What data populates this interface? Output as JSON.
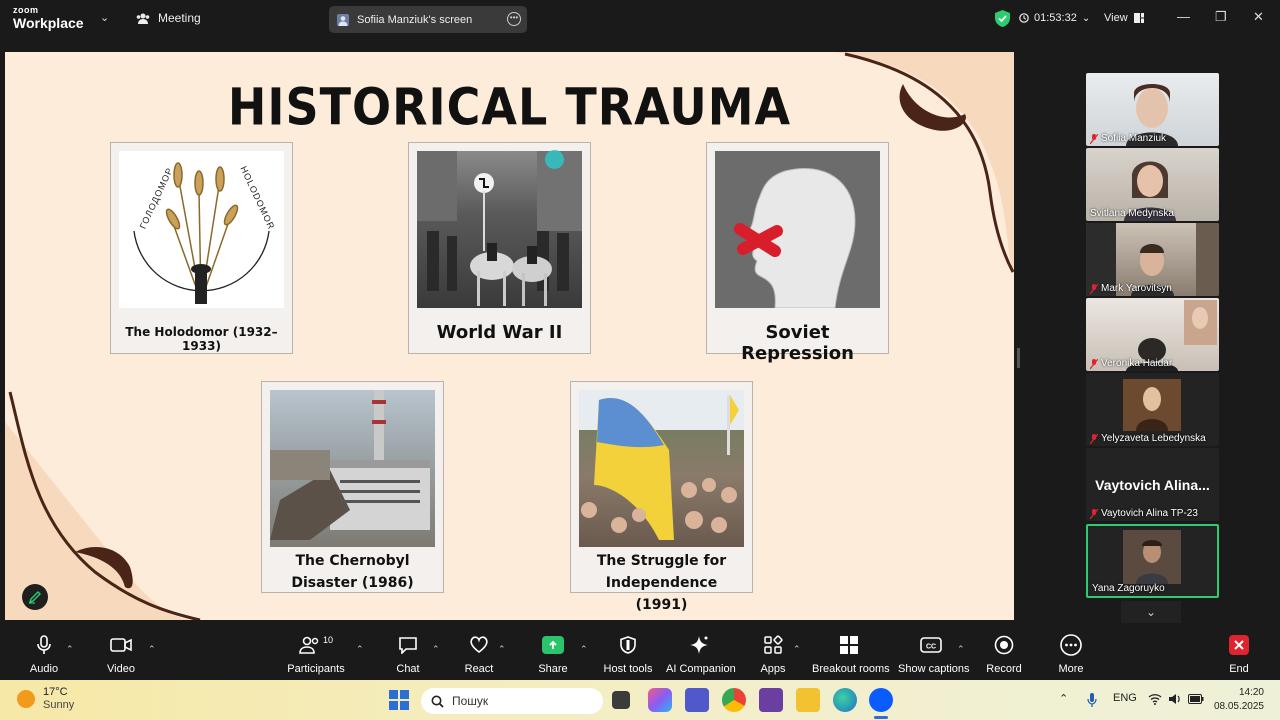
{
  "titlebar": {
    "logo_top": "zoom",
    "logo_bottom": "Workplace",
    "meeting_label": "Meeting",
    "share_label": "Sofiia Manziuk's screen",
    "timer": "01:53:32",
    "view_label": "View"
  },
  "slide": {
    "title": "HISTORICAL TRAUMA",
    "cards": [
      {
        "caption": "The Holodomor (1932–1933)",
        "image_text_left": "ГОЛОДОМОР",
        "image_text_right": "HOLODOMOR"
      },
      {
        "caption": "World War II"
      },
      {
        "caption": "Soviet Repression"
      },
      {
        "caption": "The Chernobyl Disaster (1986)"
      },
      {
        "caption": "The Struggle for Independence (1991)"
      }
    ]
  },
  "participants": {
    "tiles": [
      {
        "name": "Sofiia Manziuk",
        "muted": true
      },
      {
        "name": "Svitlana Medynska",
        "muted": false
      },
      {
        "name": "Mark Yarovitsyn",
        "muted": true
      },
      {
        "name": "Veronika Haidar",
        "muted": true
      },
      {
        "name": "Yelyzaveta Lebedynska",
        "muted": true
      },
      {
        "name": "Vaytovich Alina TP-23",
        "muted": true
      },
      {
        "name": "Yana Zagoruyko",
        "muted": false
      }
    ],
    "big_name": "Vaytovich  Alina..."
  },
  "toolbar": {
    "audio": "Audio",
    "video": "Video",
    "participants": "Participants",
    "participants_count": "10",
    "chat": "Chat",
    "react": "React",
    "share": "Share",
    "host_tools": "Host tools",
    "ai_companion": "AI Companion",
    "apps": "Apps",
    "breakout_rooms": "Breakout rooms",
    "show_captions": "Show captions",
    "record": "Record",
    "more": "More",
    "end": "End"
  },
  "taskbar": {
    "temperature": "17°C",
    "weather": "Sunny",
    "search_placeholder": "Пошук",
    "language": "ENG",
    "time": "14:20",
    "date": "08.05.2025"
  },
  "colors": {
    "slide_bg": "#fdecd9",
    "accent_green": "#2ecc71",
    "share_green": "#2bc36b",
    "end_red": "#e0242f"
  }
}
